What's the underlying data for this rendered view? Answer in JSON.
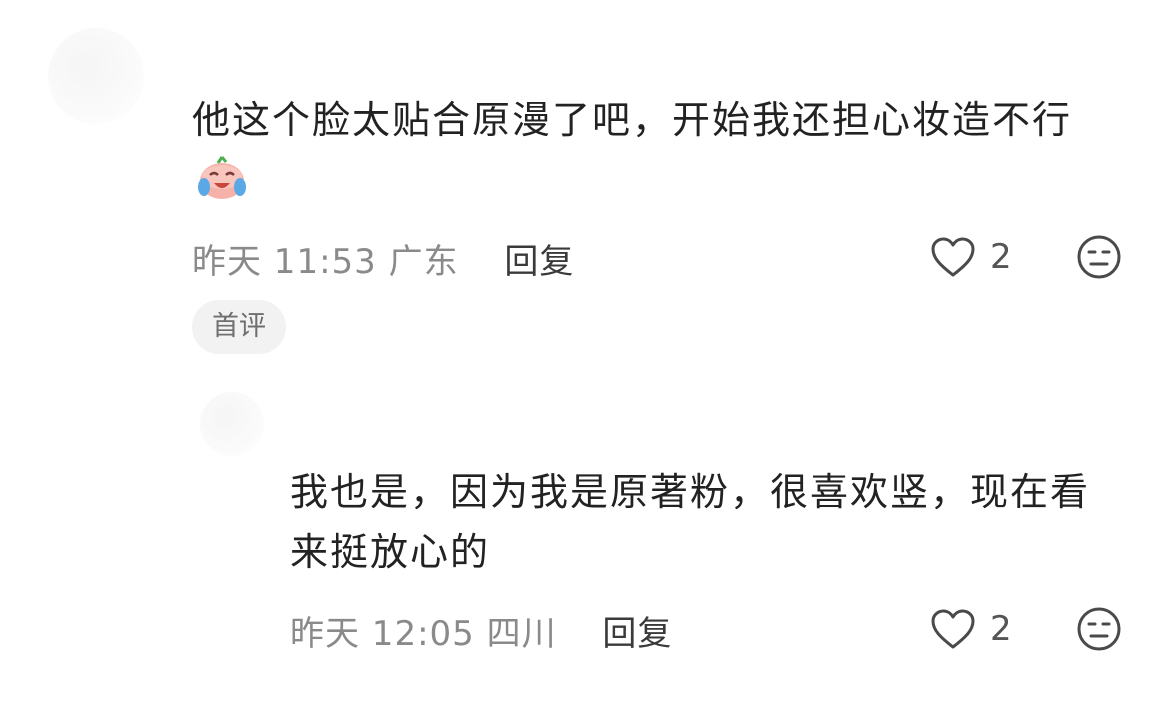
{
  "main_comment": {
    "text": "他这个脸太贴合原漫了吧，开始我还担心妆造不行",
    "emoji": "laughing-crying-emoji",
    "time": "昨天 11:53",
    "location": "广东",
    "reply_label": "回复",
    "like_count": "2",
    "tag": "首评"
  },
  "reply_comment": {
    "text": "我也是，因为我是原著粉，很喜欢竖，现在看来挺放心的",
    "time": "昨天 12:05",
    "location": "四川",
    "reply_label": "回复",
    "like_count": "2"
  },
  "colors": {
    "text": "#222222",
    "meta": "#8a8a8a",
    "tag_bg": "#f2f2f2",
    "icon": "#4a4a4a"
  },
  "icons": {
    "like": "heart-outline-icon",
    "dislike": "unamused-face-icon"
  }
}
